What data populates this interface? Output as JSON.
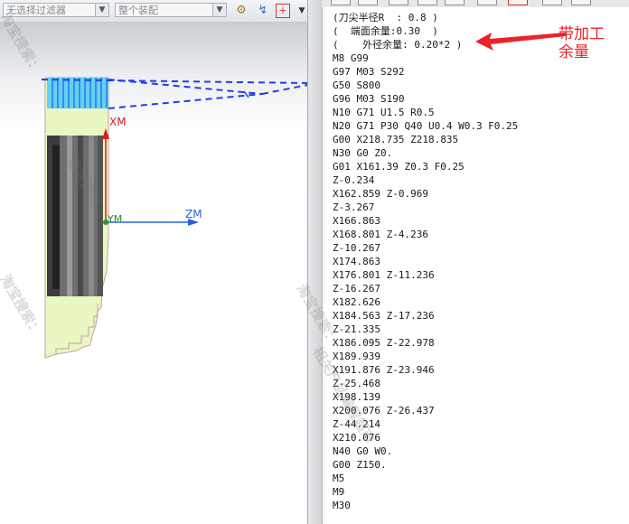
{
  "toolbar": {
    "filter_dropdown": "无选择过滤器",
    "assembly_dropdown": "整个装配",
    "icons": [
      "assembly-icon",
      "snap-icon",
      "point-snap-icon",
      "more-arrow-icon"
    ]
  },
  "viewport": {
    "axis_labels": {
      "xm": "XM",
      "ym": "YM",
      "zm": "ZM"
    }
  },
  "code": {
    "lines": [
      "(刀尖半径R  : 0.8 )",
      "(  端面余量:0.30  )",
      "(    外径余量: 0.20*2 )",
      "M8 G99",
      "G97 M03 S292",
      "G50 S800",
      "G96 M03 S190",
      "N10 G71 U1.5 R0.5",
      "N20 G71 P30 Q40 U0.4 W0.3 F0.25",
      "G00 X218.735 Z218.835",
      "N30 G0 Z0.",
      "G01 X161.39 Z0.3 F0.25",
      "Z-0.234",
      "X162.859 Z-0.969",
      "Z-3.267",
      "X166.863",
      "X168.801 Z-4.236",
      "Z-10.267",
      "X174.863",
      "X176.801 Z-11.236",
      "Z-16.267",
      "X182.626",
      "X184.563 Z-17.236",
      "Z-21.335",
      "X186.095 Z-22.978",
      "X189.939",
      "X191.876 Z-23.946",
      "Z-25.468",
      "X198.139",
      "X200.076 Z-26.437",
      "Z-44.214",
      "X210.076",
      "N40 G0 W0.",
      "G00 Z150.",
      "M5",
      "M9",
      "M30"
    ]
  },
  "annotation": {
    "line1": "带加工",
    "line2": "余量"
  },
  "watermarks": [
    "淘宝搜索：",
    "编程超市",
    "淘宝搜索：",
    "淘宝搜索：",
    "相关产品编程超市"
  ],
  "colors": {
    "toolpath": "#1f3fe6",
    "stock": "#e9f7c2",
    "annotation": "#e8242a",
    "xm_axis": "#d62020",
    "zm_axis": "#2660e0"
  }
}
